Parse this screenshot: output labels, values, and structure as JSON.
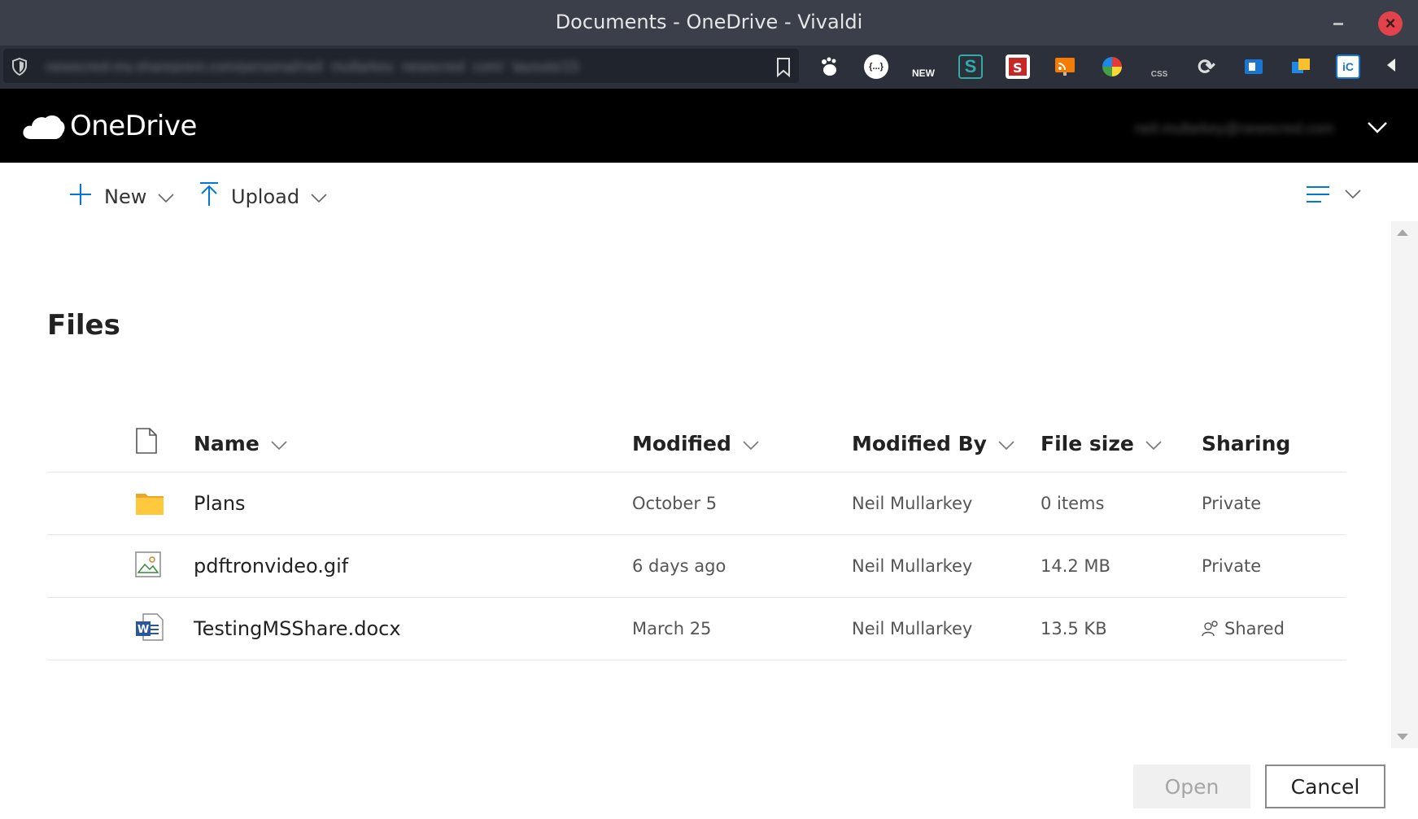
{
  "window": {
    "title": "Documents - OneDrive - Vivaldi"
  },
  "address_bar": {
    "url": "newscred-my.sharepoint.com/personal/neil_mullarkey_newscred_com/_layouts/15"
  },
  "extensions": [
    {
      "icon": "gnome-foot-icon",
      "label": ""
    },
    {
      "icon": "json-viewer-icon",
      "label": "{...}"
    },
    {
      "icon": "new-badge-icon",
      "label": "NEW"
    },
    {
      "icon": "s-extension-icon",
      "label": "S"
    },
    {
      "icon": "stylus-icon",
      "label": ""
    },
    {
      "icon": "rss-feed-icon",
      "label": ""
    },
    {
      "icon": "color-wheel-icon",
      "label": ""
    },
    {
      "icon": "css-pencil-icon",
      "label": "CSS"
    },
    {
      "icon": "sync-icon",
      "label": ""
    },
    {
      "icon": "outlook-icon",
      "label": ""
    },
    {
      "icon": "office-icon",
      "label": ""
    },
    {
      "icon": "ic-extension-icon",
      "label": "iC"
    }
  ],
  "onedrive": {
    "brand": "OneDrive",
    "account": "neil.mullarkey@newscred.com"
  },
  "toolbar": {
    "new_label": "New",
    "upload_label": "Upload"
  },
  "page_title": "Files",
  "table": {
    "columns": {
      "name": "Name",
      "modified": "Modified",
      "modified_by": "Modified By",
      "file_size": "File size",
      "sharing": "Sharing"
    },
    "rows": [
      {
        "icon": "folder-icon",
        "name": "Plans",
        "modified": "October 5",
        "modified_by": "Neil Mullarkey",
        "file_size": "0 items",
        "sharing": "Private"
      },
      {
        "icon": "image-file-icon",
        "name": "pdftronvideo.gif",
        "modified": "6 days ago",
        "modified_by": "Neil Mullarkey",
        "file_size": "14.2 MB",
        "sharing": "Private"
      },
      {
        "icon": "word-doc-icon",
        "name": "TestingMSShare.docx",
        "modified": "March 25",
        "modified_by": "Neil Mullarkey",
        "file_size": "13.5 KB",
        "sharing": "Shared"
      }
    ]
  },
  "buttons": {
    "open_label": "Open",
    "cancel_label": "Cancel"
  },
  "colors": {
    "accent": "#0078d4",
    "folder": "#ffc83d",
    "close_button": "#e2434b"
  }
}
